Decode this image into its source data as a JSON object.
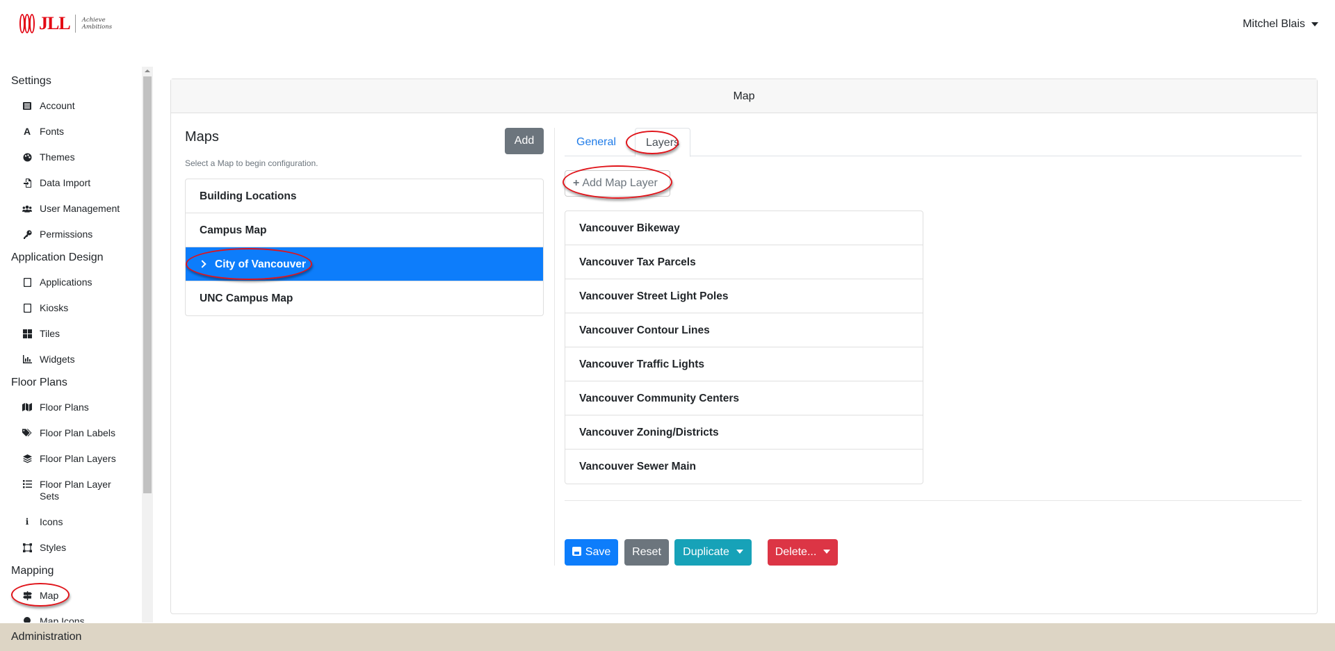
{
  "header": {
    "logo_text": "JLL",
    "tagline_line1": "Achieve",
    "tagline_line2": "Ambitions",
    "user_name": "Mitchel Blais"
  },
  "sidebar": {
    "sections": [
      {
        "title": "Settings",
        "items": [
          {
            "label": "Account",
            "icon": "list-icon"
          },
          {
            "label": "Fonts",
            "icon": "font-icon"
          },
          {
            "label": "Themes",
            "icon": "palette-icon"
          },
          {
            "label": "Data Import",
            "icon": "file-import-icon"
          },
          {
            "label": "User Management",
            "icon": "users-icon"
          },
          {
            "label": "Permissions",
            "icon": "key-icon"
          }
        ]
      },
      {
        "title": "Application Design",
        "items": [
          {
            "label": "Applications",
            "icon": "tablet-icon"
          },
          {
            "label": "Kiosks",
            "icon": "tablet-icon"
          },
          {
            "label": "Tiles",
            "icon": "grid-icon"
          },
          {
            "label": "Widgets",
            "icon": "chart-icon"
          }
        ]
      },
      {
        "title": "Floor Plans",
        "items": [
          {
            "label": "Floor Plans",
            "icon": "map-icon"
          },
          {
            "label": "Floor Plan Labels",
            "icon": "tags-icon"
          },
          {
            "label": "Floor Plan Layers",
            "icon": "layers-icon"
          },
          {
            "label": "Floor Plan Layer Sets",
            "icon": "tasks-icon"
          },
          {
            "label": "Icons",
            "icon": "info-icon"
          },
          {
            "label": "Styles",
            "icon": "vector-square-icon"
          }
        ]
      },
      {
        "title": "Mapping",
        "items": [
          {
            "label": "Map",
            "icon": "signs-icon"
          },
          {
            "label": "Map Icons",
            "icon": "map-marker-icon"
          }
        ]
      }
    ]
  },
  "card": {
    "title": "Map"
  },
  "maps_panel": {
    "title": "Maps",
    "hint": "Select a Map to begin configuration.",
    "add_label": "Add",
    "items": [
      "Building Locations",
      "Campus Map",
      "City of Vancouver",
      "UNC Campus Map"
    ],
    "selected": "City of Vancouver"
  },
  "tabs": {
    "general": "General",
    "layers": "Layers",
    "active": "Layers"
  },
  "layers_panel": {
    "add_layer_label": "Add Map Layer",
    "items": [
      "Vancouver Bikeway",
      "Vancouver Tax Parcels",
      "Vancouver Street Light Poles",
      "Vancouver Contour Lines",
      "Vancouver Traffic Lights",
      "Vancouver Community Centers",
      "Vancouver Zoning/Districts",
      "Vancouver Sewer Main"
    ]
  },
  "actions": {
    "save": "Save",
    "reset": "Reset",
    "duplicate": "Duplicate",
    "delete": "Delete..."
  },
  "footer": {
    "label": "Administration"
  },
  "colors": {
    "brand_red": "#e30613",
    "primary": "#0d7dfb",
    "secondary": "#6c757d",
    "info": "#17a2b8",
    "danger": "#dc3545",
    "footer_bg": "#ddd5c5",
    "annotation": "#e0141a"
  }
}
